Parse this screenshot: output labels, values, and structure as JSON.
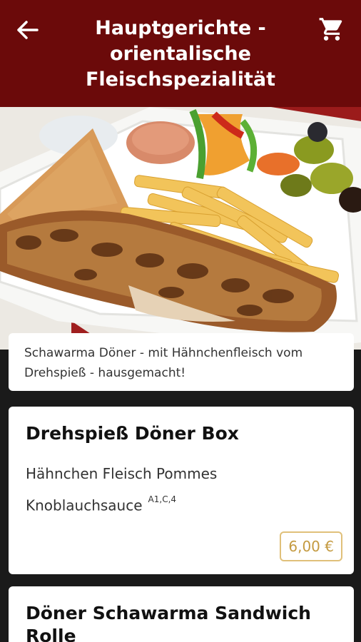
{
  "header": {
    "title": "Hauptgerichte - orientalische Fleischspezialität",
    "back_icon": "arrow-left-icon",
    "cart_icon": "shopping-cart-icon"
  },
  "category_description": "Schawarma Döner - mit Hähnchenfleisch vom Drehspieß - hausgemacht!",
  "items": [
    {
      "name": "Drehspieß Döner Box",
      "description": "Hähnchen Fleisch Pommes Knoblauchsauce",
      "allergens": "A1,C,4",
      "price": "6,00 €"
    },
    {
      "name": "Döner Schawarma Sandwich Rolle"
    }
  ],
  "colors": {
    "header_bg": "#6b0a0a",
    "price_border": "#e0c07a",
    "price_text": "#c49a40"
  }
}
